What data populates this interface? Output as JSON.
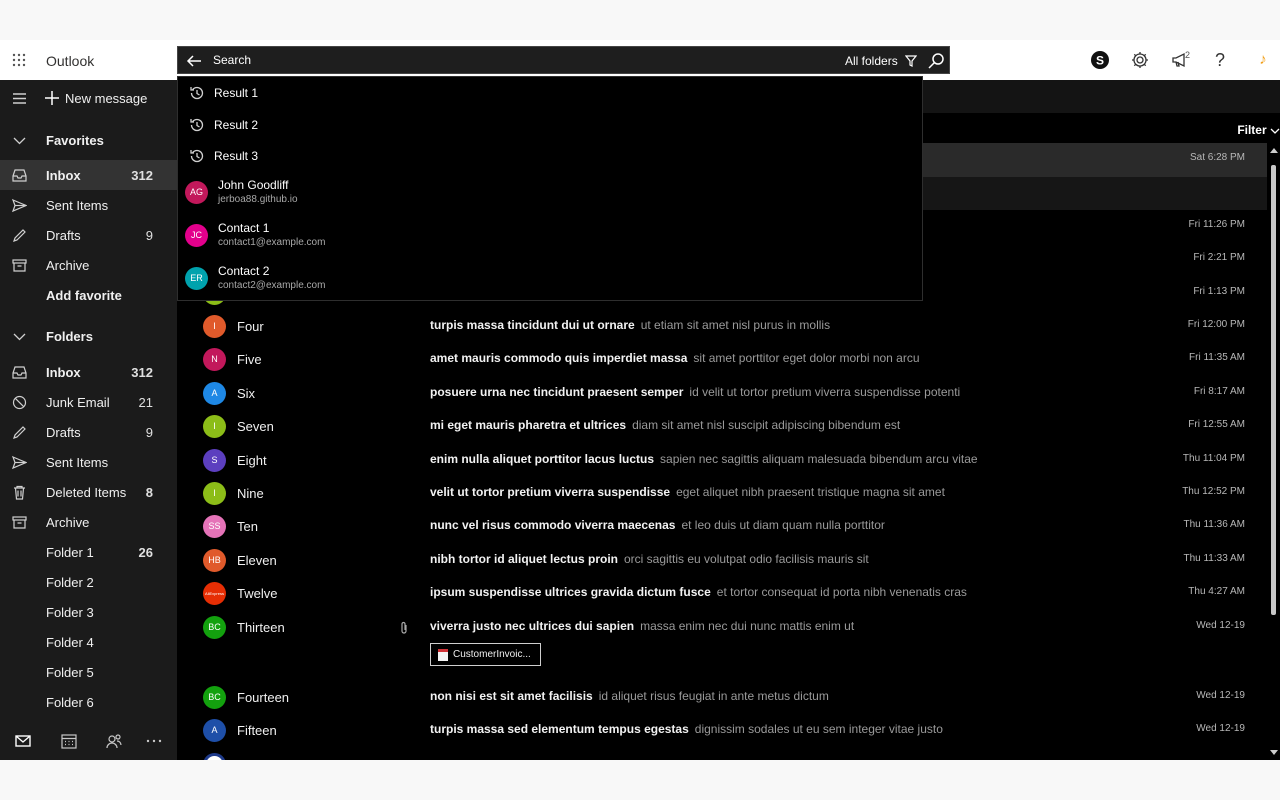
{
  "app": {
    "title": "Outlook"
  },
  "header": {
    "notifications_badge": "2"
  },
  "search": {
    "query": "Search",
    "scope": "All folders"
  },
  "suggestions": {
    "history": [
      "Result 1",
      "Result 2",
      "Result 3"
    ],
    "contacts": [
      {
        "initials": "AG",
        "name": "John Goodliff",
        "email": "jerboa88.github.io",
        "color": "#c2185b"
      },
      {
        "initials": "JC",
        "name": "Contact 1",
        "email": "contact1@example.com",
        "color": "#e3008c"
      },
      {
        "initials": "ER",
        "name": "Contact 2",
        "email": "contact2@example.com",
        "color": "#00a2ad"
      }
    ]
  },
  "sidebar": {
    "new_message": "New message",
    "favorites_header": "Favorites",
    "favorites": [
      {
        "label": "Inbox",
        "count": "312",
        "icon": "inbox-icon"
      },
      {
        "label": "Sent Items",
        "count": "",
        "icon": "send-icon"
      },
      {
        "label": "Drafts",
        "count": "9",
        "icon": "pencil-icon"
      },
      {
        "label": "Archive",
        "count": "",
        "icon": "archive-icon"
      }
    ],
    "add_favorite": "Add favorite",
    "folders_header": "Folders",
    "folders": [
      {
        "label": "Inbox",
        "count": "312",
        "icon": "inbox-icon"
      },
      {
        "label": "Junk Email",
        "count": "21",
        "icon": "block-icon"
      },
      {
        "label": "Drafts",
        "count": "9",
        "icon": "pencil-icon"
      },
      {
        "label": "Sent Items",
        "count": "",
        "icon": "send-icon"
      },
      {
        "label": "Deleted Items",
        "count": "8",
        "icon": "trash-icon"
      },
      {
        "label": "Archive",
        "count": "",
        "icon": "archive-icon"
      },
      {
        "label": "Folder 1",
        "count": "26",
        "icon": ""
      },
      {
        "label": "Folder 2",
        "count": "",
        "icon": ""
      },
      {
        "label": "Folder 3",
        "count": "",
        "icon": ""
      },
      {
        "label": "Folder 4",
        "count": "",
        "icon": ""
      },
      {
        "label": "Folder 5",
        "count": "",
        "icon": ""
      },
      {
        "label": "Folder 6",
        "count": "",
        "icon": ""
      }
    ]
  },
  "message_list": {
    "filter_label": "Filter",
    "messages": [
      {
        "initials": "",
        "sender": "",
        "subject": "",
        "preview": "",
        "time": "Sat 6:28 PM",
        "color": "#000000"
      },
      {
        "initials": "",
        "sender": "",
        "subject": "",
        "preview": "",
        "time": "",
        "color": "#000000"
      },
      {
        "initials": "",
        "sender": "",
        "subject": "",
        "preview": "",
        "time": "Fri 11:26 PM",
        "color": "#000000"
      },
      {
        "initials": "",
        "sender": "",
        "subject": "",
        "preview": "",
        "time": "Fri 2:21 PM",
        "color": "#000000"
      },
      {
        "initials": "",
        "sender": "",
        "subject": "",
        "preview": "",
        "time": "Fri 1:13 PM",
        "color": "#8cbd18"
      },
      {
        "initials": "I",
        "sender": "Four",
        "subject": "turpis massa tincidunt dui ut ornare",
        "preview": "ut etiam sit amet nisl purus in mollis",
        "time": "Fri 12:00 PM",
        "color": "#e05a2b"
      },
      {
        "initials": "N",
        "sender": "Five",
        "subject": "amet mauris commodo quis imperdiet massa",
        "preview": "sit amet porttitor eget dolor morbi non arcu",
        "time": "Fri 11:35 AM",
        "color": "#c2185b"
      },
      {
        "initials": "A",
        "sender": "Six",
        "subject": "posuere urna nec tincidunt praesent semper",
        "preview": "id velit ut tortor pretium viverra suspendisse potenti",
        "time": "Fri 8:17 AM",
        "color": "#1e88e5"
      },
      {
        "initials": "I",
        "sender": "Seven",
        "subject": "mi eget mauris pharetra et ultrices",
        "preview": "diam sit amet nisl suscipit adipiscing bibendum est",
        "time": "Fri 12:55 AM",
        "color": "#8cbd18"
      },
      {
        "initials": "S",
        "sender": "Eight",
        "subject": "enim nulla aliquet porttitor lacus luctus",
        "preview": "sapien nec sagittis aliquam malesuada bibendum arcu vitae",
        "time": "Thu 11:04 PM",
        "color": "#5c3fbf"
      },
      {
        "initials": "I",
        "sender": "Nine",
        "subject": "velit ut tortor pretium viverra suspendisse",
        "preview": "eget aliquet nibh praesent tristique magna sit amet",
        "time": "Thu 12:52 PM",
        "color": "#8cbd18"
      },
      {
        "initials": "SS",
        "sender": "Ten",
        "subject": "nunc vel risus commodo viverra maecenas",
        "preview": "et leo duis ut diam quam nulla porttitor",
        "time": "Thu 11:36 AM",
        "color": "#e573b8"
      },
      {
        "initials": "HB",
        "sender": "Eleven",
        "subject": "nibh tortor id aliquet lectus proin",
        "preview": "orci sagittis eu volutpat odio facilisis mauris sit",
        "time": "Thu 11:33 AM",
        "color": "#e05a2b"
      },
      {
        "initials": "AliExpress",
        "sender": "Twelve",
        "subject": "ipsum suspendisse ultrices gravida dictum fusce",
        "preview": "et tortor consequat id porta nibh venenatis cras",
        "time": "Thu 4:27 AM",
        "color": "#e62e04"
      },
      {
        "initials": "BC",
        "sender": "Thirteen",
        "subject": "viverra justo nec ultrices dui sapien",
        "preview": "massa enim nec dui nunc mattis enim ut",
        "time": "Wed 12-19",
        "color": "#13a10e"
      },
      {
        "initials": "BC",
        "sender": "Fourteen",
        "subject": "non nisi est sit amet facilisis",
        "preview": "id aliquet risus feugiat in ante metus dictum",
        "time": "Wed 12-19",
        "color": "#13a10e"
      },
      {
        "initials": "A",
        "sender": "Fifteen",
        "subject": "turpis massa sed elementum tempus egestas",
        "preview": "dignissim sodales ut eu sem integer vitae justo",
        "time": "Wed 12-19",
        "color": "#1e4fa8"
      }
    ],
    "attachment_name": "CustomerInvoic..."
  }
}
